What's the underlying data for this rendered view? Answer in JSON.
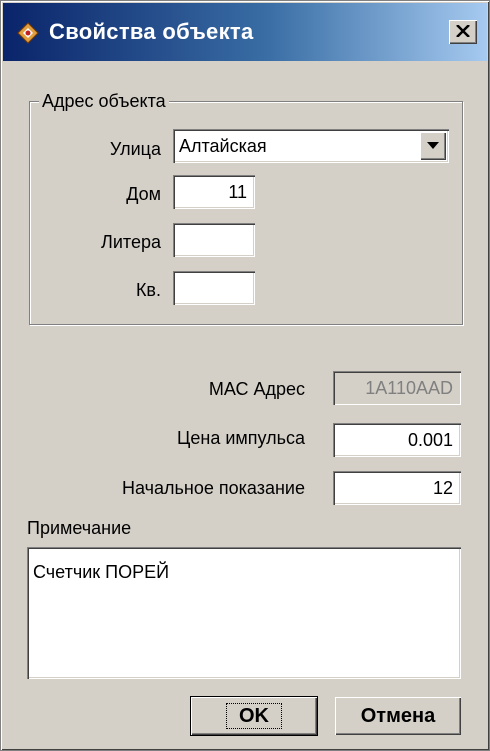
{
  "window": {
    "title": "Свойства объекта",
    "icon": "object-properties-icon",
    "close_icon": "close-icon"
  },
  "address_group": {
    "legend": "Адрес объекта",
    "street_label": "Улица",
    "street_value": "Алтайская",
    "house_label": "Дом",
    "house_value": "11",
    "letter_label": "Литера",
    "letter_value": "",
    "apartment_label": "Кв.",
    "apartment_value": ""
  },
  "meter": {
    "mac_label": "МАС Адрес",
    "mac_value": "1A110AAD",
    "pulse_price_label": "Цена импульса",
    "pulse_price_value": "0.001",
    "initial_reading_label": "Начальное показание",
    "initial_reading_value": "12"
  },
  "note": {
    "label": "Примечание",
    "value": "Счетчик ПОРЕЙ"
  },
  "buttons": {
    "ok": "OK",
    "cancel": "Отмена"
  },
  "colors": {
    "face": "#d4d0c8",
    "title_start": "#0a246a",
    "title_end": "#a6caf0"
  }
}
